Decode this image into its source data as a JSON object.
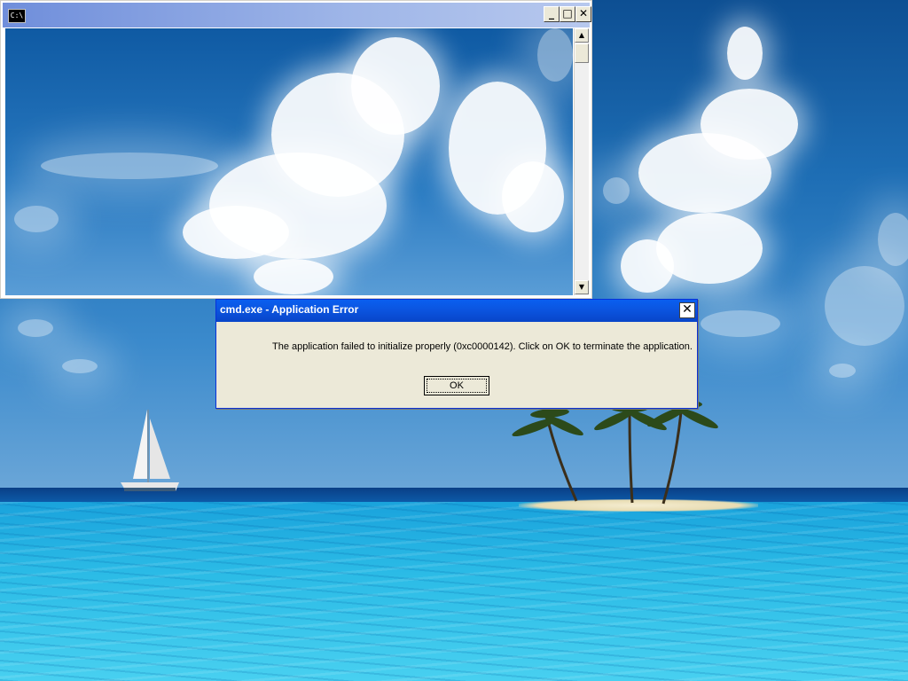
{
  "console_window": {
    "icon_text": "C:\\",
    "minimize_glyph": "_",
    "maximize_glyph": "□",
    "close_glyph": "✕",
    "scroll_up_glyph": "▲",
    "scroll_down_glyph": "▼"
  },
  "error_dialog": {
    "title": "cmd.exe - Application Error",
    "close_glyph": "✕",
    "message": "The application failed to initialize properly (0xc0000142). Click on OK to terminate the application.",
    "ok_label": "OK"
  },
  "icons": {
    "console_icon": "command-prompt-icon",
    "minimize": "minimize-icon",
    "maximize": "maximize-icon",
    "close": "close-icon",
    "scroll_up": "scroll-up-arrow-icon",
    "scroll_down": "scroll-down-arrow-icon"
  },
  "colors": {
    "dialog_title_bar": "#0b53de",
    "console_title_bar_inactive": "#9fb6e8",
    "dialog_face": "#ece9d8"
  }
}
